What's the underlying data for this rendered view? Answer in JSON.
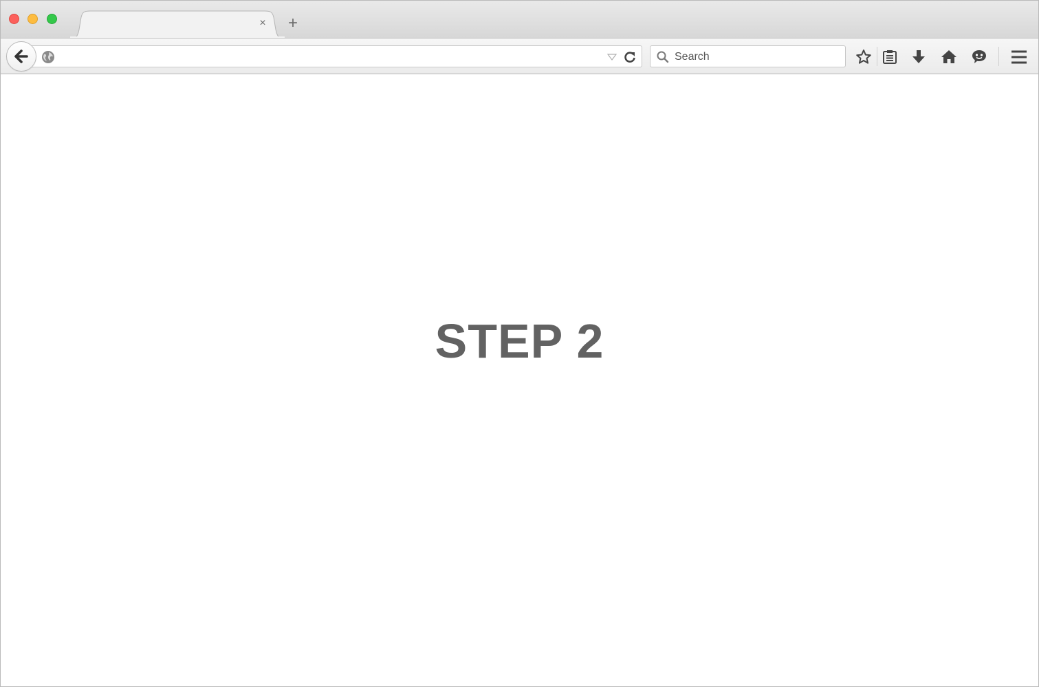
{
  "window": {
    "buttons": [
      "close",
      "minimize",
      "zoom"
    ]
  },
  "tabs": [
    {
      "title": "",
      "close_label": "×"
    }
  ],
  "new_tab_label": "+",
  "navbar": {
    "url_value": "",
    "search_placeholder": "Search",
    "toolbar_icons": [
      "star-icon",
      "reading-list-icon",
      "download-icon",
      "home-icon",
      "chat-icon",
      "menu-icon"
    ]
  },
  "content": {
    "heading": "STEP 2"
  },
  "colors": {
    "close": "#fc605c",
    "minimize": "#fdbc40",
    "zoom": "#34c84a",
    "heading": "#626262",
    "icon": "#4a4a4a"
  }
}
